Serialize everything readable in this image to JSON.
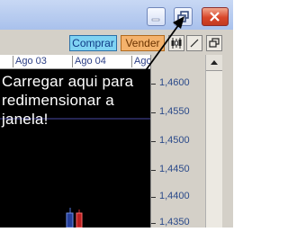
{
  "window": {
    "controls": {
      "minimize_icon": "minimize-icon",
      "maximize_icon": "restore-window-icon",
      "close_icon": "close-icon"
    }
  },
  "toolbar": {
    "buy_label": "Comprar",
    "sell_label": "Vender",
    "candle_icon": "candlestick-icon",
    "line_icon": "line-tool-icon",
    "restore_icon": "restore-panel-icon"
  },
  "dates": [
    "Ago 03",
    "Ago 04",
    "Ago"
  ],
  "price_axis": [
    "1,4600",
    "1,4550",
    "1,4500",
    "1,4450",
    "1,4400",
    "1,4350"
  ],
  "annotation": {
    "line1": "Carregar aqui para",
    "line2": "redimensionar a",
    "line3": "janela!"
  },
  "colors": {
    "buy": "#7fd3f3",
    "sell": "#f4b26c",
    "chart_bg": "#000000",
    "close": "#d9472a"
  }
}
